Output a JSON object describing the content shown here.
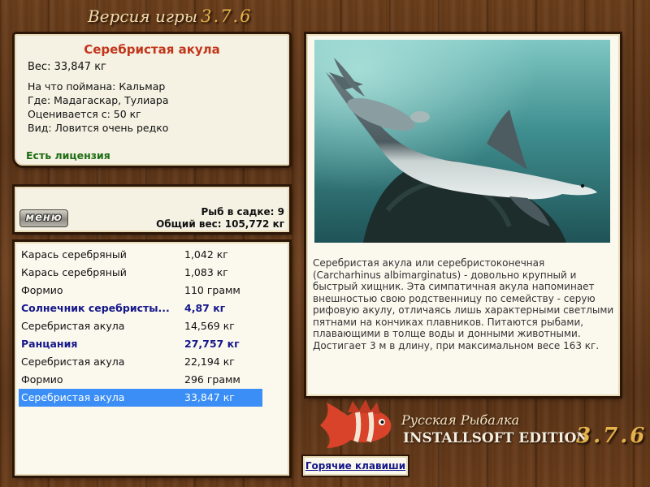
{
  "header": {
    "version_label": "Версия игры",
    "version_number": "3.7.6"
  },
  "fish_card": {
    "name": "Серебристая акула",
    "weight": "Вес: 33,847 кг",
    "caught_on": "На что поймана: Кальмар",
    "location": "Где: Мадагаскар, Тулиара",
    "valued": "Оценивается с: 50 кг",
    "rarity": "Вид: Ловится очень редко",
    "license": "Есть лицензия"
  },
  "keepnet": {
    "menu_label": "меню",
    "count": "Рыб в садке: 9",
    "total_weight": "Общий вес: 105,772 кг"
  },
  "catch_list": [
    {
      "name": "Карась серебряный",
      "weight": "1,042 кг",
      "bold": false,
      "selected": false
    },
    {
      "name": "Карась серебряный",
      "weight": "1,083 кг",
      "bold": false,
      "selected": false
    },
    {
      "name": "Формио",
      "weight": "110 грамм",
      "bold": false,
      "selected": false
    },
    {
      "name": "Солнечник серебристы...",
      "weight": "4,87 кг",
      "bold": true,
      "selected": false
    },
    {
      "name": "Серебристая акула",
      "weight": "14,569 кг",
      "bold": false,
      "selected": false
    },
    {
      "name": "Ранцания",
      "weight": "27,757 кг",
      "bold": true,
      "selected": false
    },
    {
      "name": "Серебристая акула",
      "weight": "22,194 кг",
      "bold": false,
      "selected": false
    },
    {
      "name": "Формио",
      "weight": "296 грамм",
      "bold": false,
      "selected": false
    },
    {
      "name": "Серебристая акула",
      "weight": "33,847 кг",
      "bold": false,
      "selected": true
    }
  ],
  "description": "Серебристая акула или серебристоконечная (Carcharhinus albimarginatus) - довольно крупный и быстрый хищник. Эта симпатичная акула напоминает внешностью свою родственницу по семейству - серую рифовую акулу, отличаясь лишь характерными светлыми пятнами на кончиках плавников. Питаются рыбами, плавающими в толще воды и донными животными. Достигает 3 м в длину, при максимальном весе 163 кг.",
  "branding": {
    "line1": "Русская Рыбалка",
    "line2": "INSTALLSOFT EDITION",
    "version": "3.7.6"
  },
  "hotkeys_label": "Горячие клавиши",
  "colors": {
    "title_red": "#c2361a",
    "license_green": "#1d6e14",
    "record_blue": "#15188a",
    "selection_blue": "#3a8ef5",
    "wood": "#5a3316"
  },
  "icons": [
    "fish-photo",
    "logo-fish-icon"
  ]
}
